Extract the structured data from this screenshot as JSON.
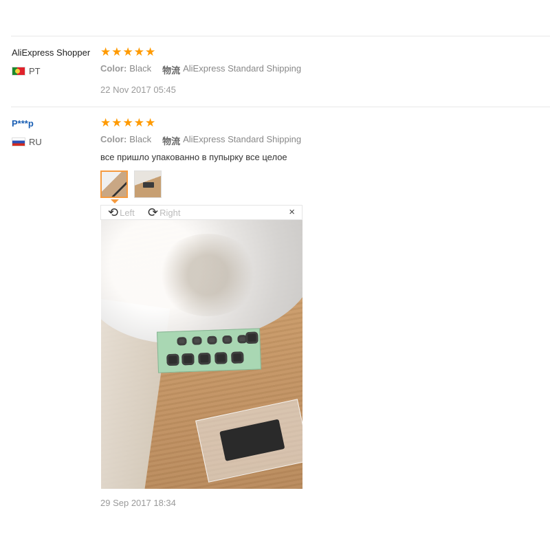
{
  "reviews": [
    {
      "user": "AliExpress Shopper",
      "country_code": "PT",
      "rating": 5,
      "color_label": "Color:",
      "color_value": "Black",
      "shipping_label": "物流",
      "shipping_value": "AliExpress Standard Shipping",
      "date": "22 Nov 2017 05:45"
    },
    {
      "user": "P***p",
      "country_code": "RU",
      "rating": 5,
      "color_label": "Color:",
      "color_value": "Black",
      "shipping_label": "物流",
      "shipping_value": "AliExpress Standard Shipping",
      "feedback": "все пришло упакованно в пупырку все целое",
      "date": "29 Sep 2017 18:34"
    }
  ],
  "viewer": {
    "rotate_left": "Left",
    "rotate_right": "Right",
    "close": "×"
  },
  "colors": {
    "star": "#ff9a00",
    "link": "#1a5fb4",
    "thumb_active_border": "#f59a3f"
  }
}
